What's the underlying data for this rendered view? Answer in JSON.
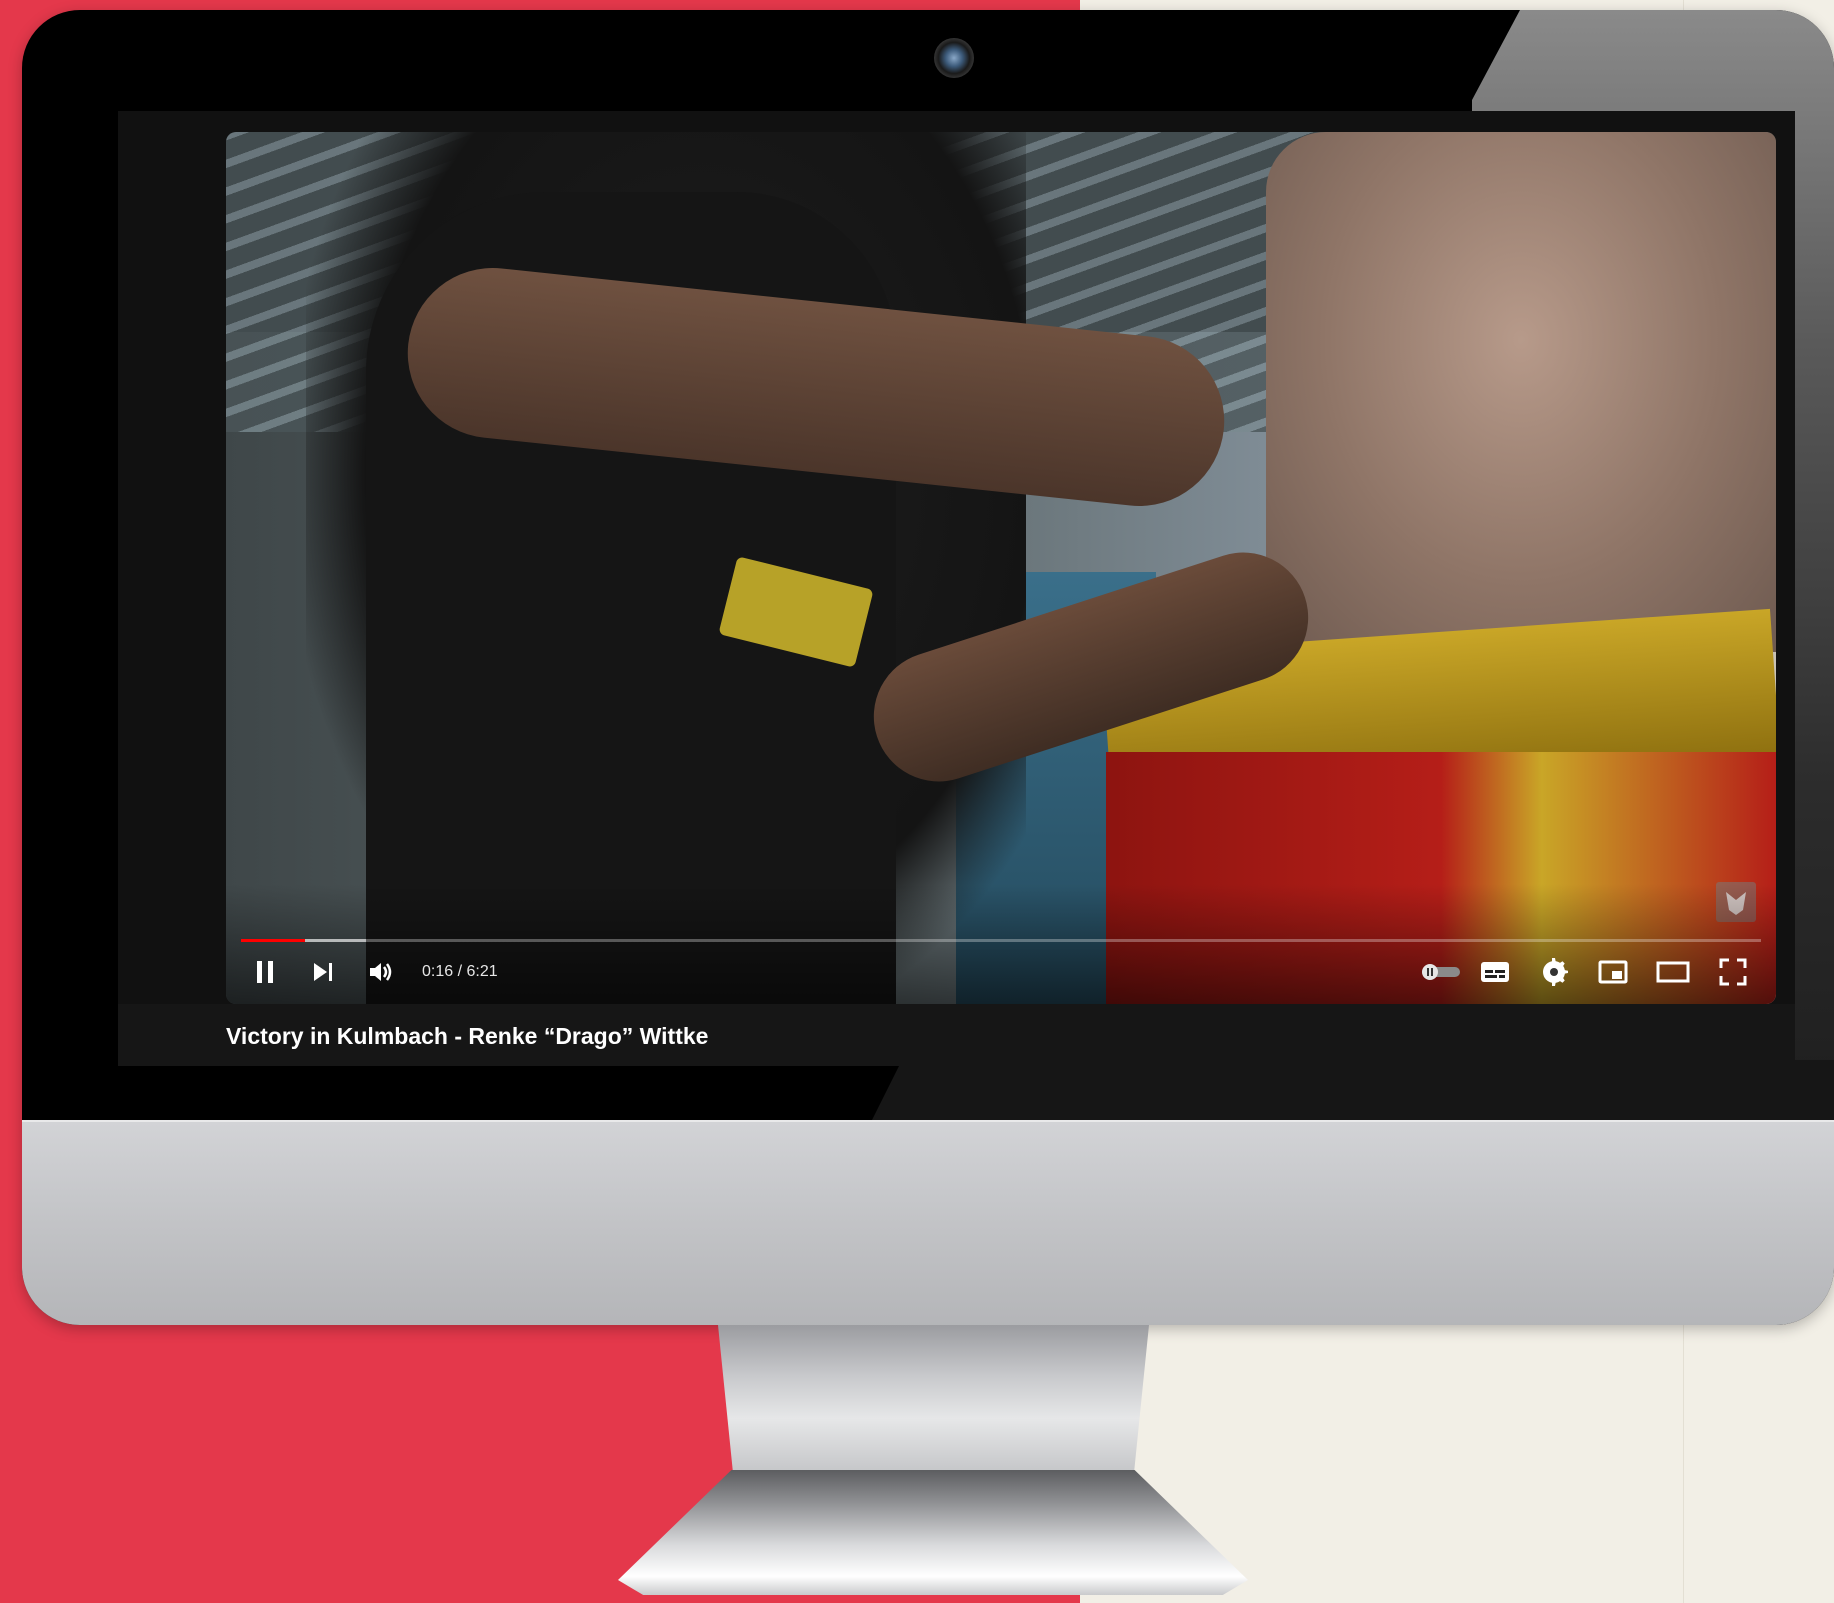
{
  "video": {
    "title": "Victory in Kulmbach - Renke “Drago” Wittke",
    "time_current": "0:16",
    "time_total": "6:21",
    "time_display": "0:16 / 6:21",
    "progress_played_fraction": 0.042,
    "progress_buffered_fraction": 0.082
  },
  "controls": {
    "icons": [
      "pause-icon",
      "next-icon",
      "volume-icon",
      "autoplay-toggle-icon",
      "subtitles-icon",
      "settings-icon",
      "miniplayer-icon",
      "theater-mode-icon",
      "fullscreen-icon"
    ]
  },
  "colors": {
    "progress_red": "#ff0000",
    "background_red": "#e4384b",
    "background_cream": "#f2efe6"
  }
}
